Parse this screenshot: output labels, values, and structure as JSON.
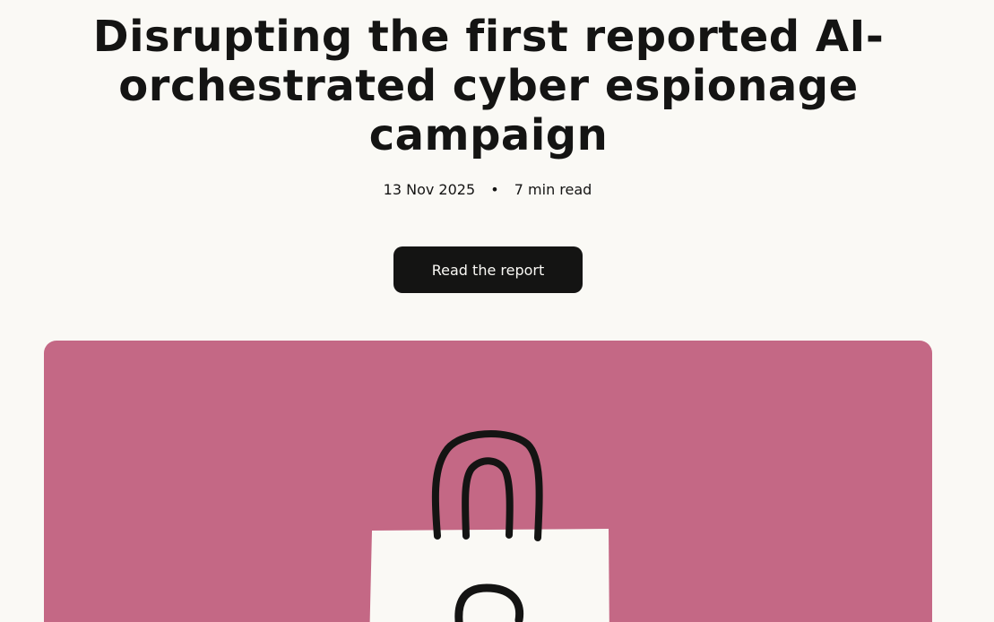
{
  "article": {
    "title": "Disrupting the first reported AI-orchestrated cyber espionage campaign",
    "date": "13 Nov 2025",
    "separator": "•",
    "read_time": "7 min read",
    "cta_label": "Read the report"
  },
  "hero": {
    "background_color": "#c46885",
    "illustration": "shopping-bag-with-lock-icon"
  }
}
